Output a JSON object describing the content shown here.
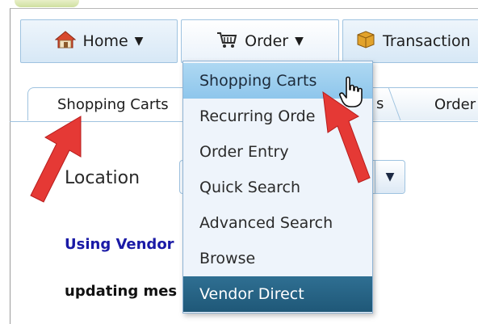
{
  "menu": {
    "home_label": "Home",
    "order_label": "Order",
    "transactions_label": "Transaction",
    "caret": "▼"
  },
  "tabs": {
    "active_label": "Shopping Carts",
    "partial_middle": "s",
    "partial_right": "Order"
  },
  "dropdown": {
    "items": [
      {
        "label": "Shopping Carts",
        "state": "hover"
      },
      {
        "label": "Recurring Orde",
        "state": "normal"
      },
      {
        "label": "Order Entry",
        "state": "normal"
      },
      {
        "label": "Quick Search",
        "state": "normal"
      },
      {
        "label": "Advanced Search",
        "state": "normal"
      },
      {
        "label": "Browse",
        "state": "normal"
      },
      {
        "label": "Vendor Direct",
        "state": "active"
      }
    ]
  },
  "form": {
    "location_label": "Location",
    "select_arrow": "▼"
  },
  "content": {
    "vendor_link": "Using Vendor",
    "updating_text": "updating mes"
  },
  "colors": {
    "annotation_arrow": "#e53935",
    "menu_hover": "#9fd0f0",
    "menu_active": "#27678a",
    "link": "#1a1aa6"
  }
}
